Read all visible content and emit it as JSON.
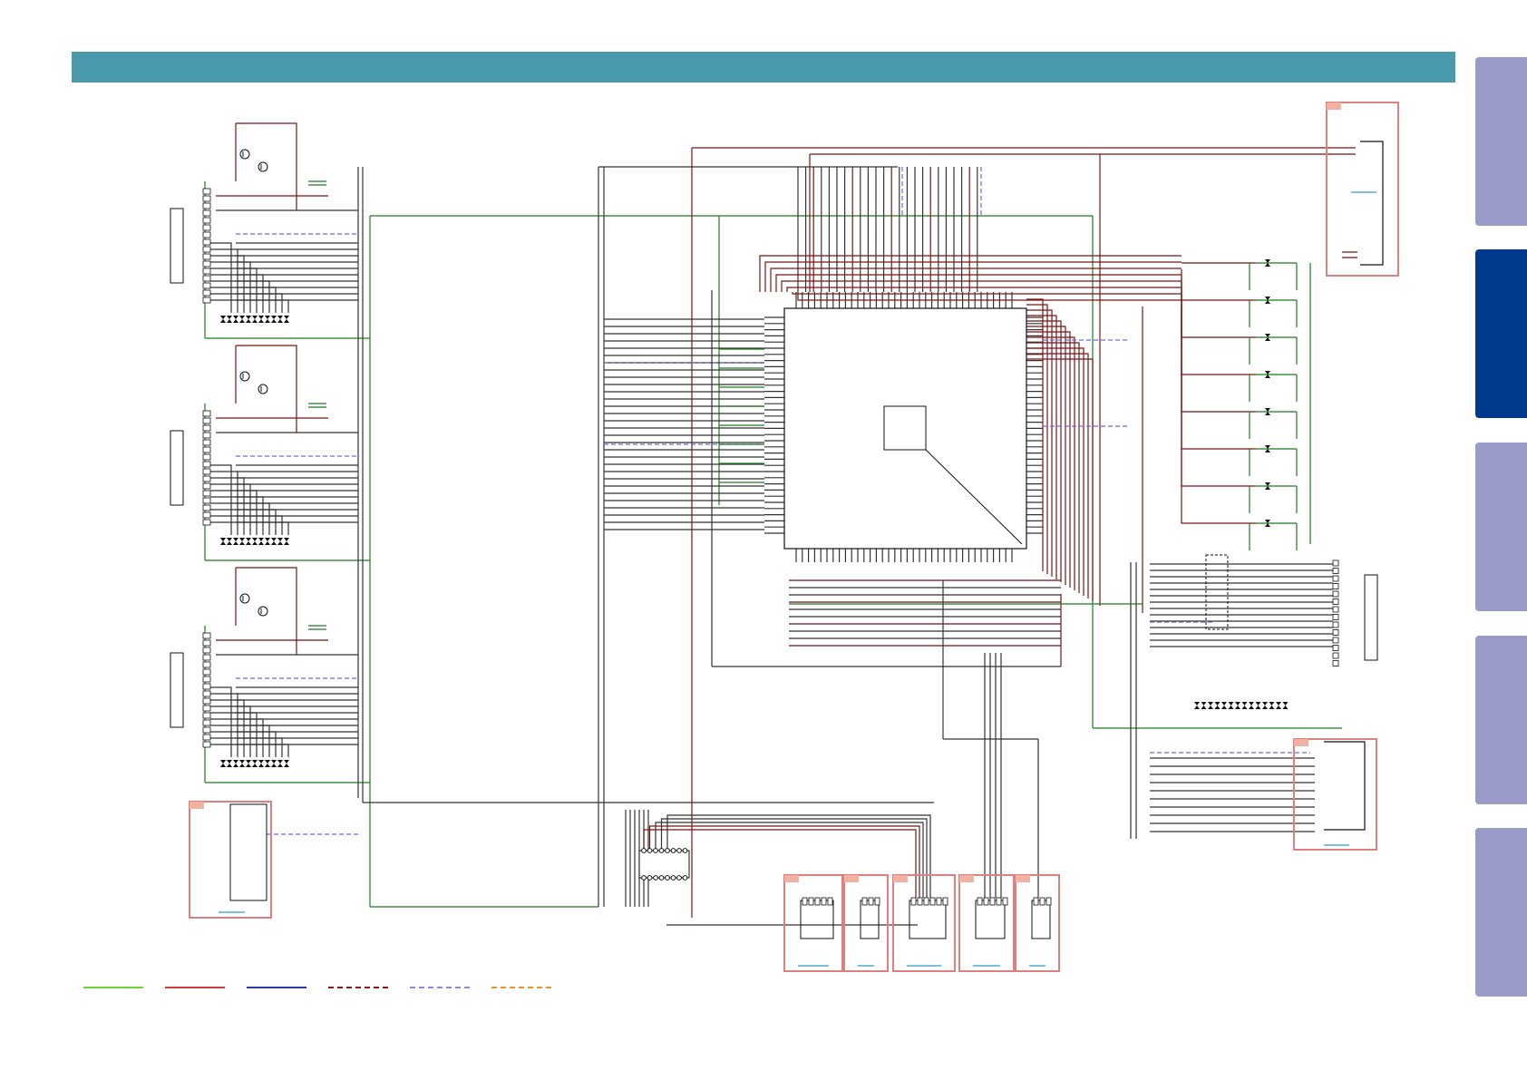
{
  "colors": {
    "header_bar": "#4a9aae",
    "tab_inactive": "#9b9bc9",
    "tab_active": "#003a8c",
    "wire_ground": "#1f7a1f",
    "wire_power": "#7a1414",
    "wire_signal": "#333333",
    "wire_bus_dashed": "#6a6ad8",
    "sub_board_frame": "#e07f7f",
    "sub_board_tag": "#f2b2a2",
    "sub_board_ref": "#2a9acc"
  },
  "side_tabs": [
    {
      "state": "inactive"
    },
    {
      "state": "active"
    },
    {
      "state": "inactive"
    },
    {
      "state": "inactive"
    },
    {
      "state": "inactive"
    }
  ],
  "legend": [
    {
      "style": "solid",
      "color": "#6ad63a"
    },
    {
      "style": "solid",
      "color": "#d23a3a"
    },
    {
      "style": "solid",
      "color": "#2a3aa8"
    },
    {
      "style": "dashed",
      "color": "#8a1a1a"
    },
    {
      "style": "dashed",
      "color": "#8a8ad8"
    },
    {
      "style": "dashed",
      "color": "#e0962a"
    }
  ],
  "icons": {
    "transistor": "transistor-symbol",
    "diode": "diode-symbol",
    "connector": "connector-pin-strip",
    "ic": "integrated-circuit-package"
  }
}
